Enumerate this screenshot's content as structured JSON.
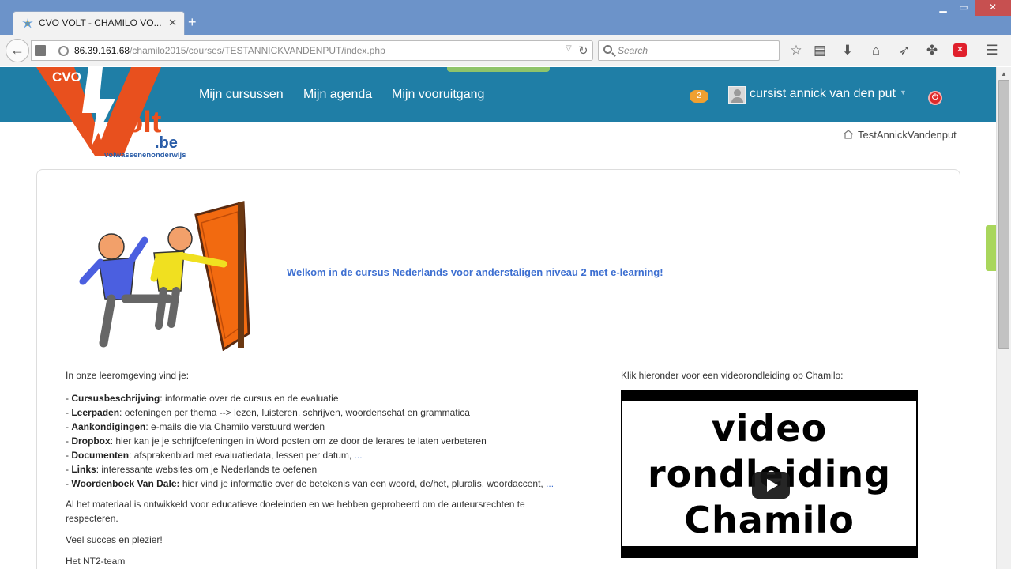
{
  "browser": {
    "tab_title": "CVO VOLT - CHAMILO VO...",
    "tab_close": "✕",
    "new_tab": "+",
    "window_controls": {
      "minimize": "▁",
      "maximize": "▭",
      "close": "✕"
    },
    "back": "←",
    "url_host": "86.39.161.68",
    "url_path": "/chamilo2015/courses/TESTANNICKVANDENPUT/index.php",
    "search_placeholder": "Search",
    "toolbar_icons": [
      "star-icon",
      "reading-list-icon",
      "download-icon",
      "home-icon",
      "send-icon",
      "extension-icon",
      "pdf-icon",
      "menu-icon"
    ]
  },
  "header": {
    "logo": {
      "brand": "CVO",
      "wordmark": "Volt",
      "domain": ".be",
      "tagline": "volwassenenonderwijs"
    },
    "nav": [
      "Mijn cursussen",
      "Mijn agenda",
      "Mijn vooruitgang"
    ],
    "message_count": "2",
    "user_name": "cursist annick van den put"
  },
  "breadcrumb": {
    "course": "TestAnnickVandenput"
  },
  "content": {
    "welcome": "Welkom in de cursus Nederlands voor anderstaligen niveau 2 met e-learning!",
    "intro": "In onze leeromgeving vind je:",
    "features": [
      {
        "term": "Cursusbeschrijving",
        "desc": ": informatie over de cursus en de evaluatie",
        "more": ""
      },
      {
        "term": "Leerpaden",
        "desc": ": oefeningen per thema --> lezen, luisteren, schrijven, woordenschat en grammatica",
        "more": ""
      },
      {
        "term": "Aankondigingen",
        "desc": ": e-mails die via Chamilo verstuurd werden",
        "more": ""
      },
      {
        "term": "Dropbox",
        "desc": ": hier kan je je schrijfoefeningen in Word posten om ze door de lerares te laten verbeteren",
        "more": ""
      },
      {
        "term": "Documenten",
        "desc": ": afsprakenblad met evaluatiedata, lessen per datum, ",
        "more": "..."
      },
      {
        "term": "Links",
        "desc": ": interessante websites om je Nederlands te oefenen",
        "more": ""
      },
      {
        "term": "Woordenboek Van Dale:",
        "desc": " hier vind je informatie over de betekenis van een woord, de/het, pluralis, woordaccent, ",
        "more": "..."
      }
    ],
    "disclaimer": "Al het materiaal is ontwikkeld voor educatieve doeleinden en we hebben geprobeerd om de auteursrechten te respecteren.",
    "wish": "Veel succes en plezier!",
    "signature": "Het NT2-team",
    "video_intro": "Klik hieronder voor een videorondleiding op Chamilo:",
    "video_lines": [
      "video",
      "rondleiding",
      "Chamilo"
    ]
  },
  "colors": {
    "header_bg": "#1f7ea6",
    "logo_orange": "#e8501e",
    "link_blue": "#3d6fd1",
    "badge_orange": "#f0a030"
  }
}
